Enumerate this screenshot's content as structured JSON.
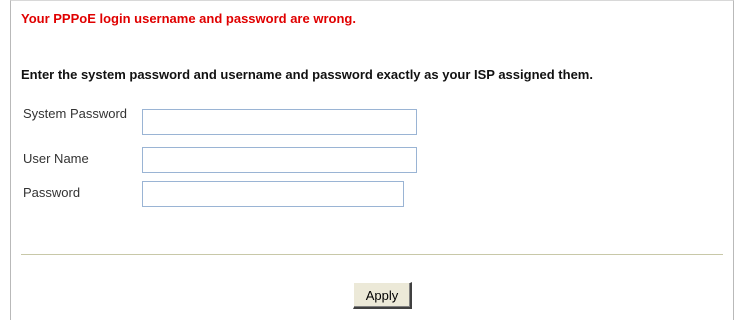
{
  "messages": {
    "error": "Your PPPoE login username and password are wrong.",
    "instruction": "Enter the system password and username and password exactly as your ISP assigned them."
  },
  "form": {
    "system_password": {
      "label": "System Password",
      "value": ""
    },
    "user_name": {
      "label": "User Name",
      "value": ""
    },
    "password": {
      "label": "Password",
      "value": ""
    }
  },
  "actions": {
    "apply_label": "Apply"
  },
  "colors": {
    "error": "#e00000",
    "input_border": "#9ab4d4",
    "divider": "#c8c8a8",
    "button_face": "#ece9d8"
  }
}
